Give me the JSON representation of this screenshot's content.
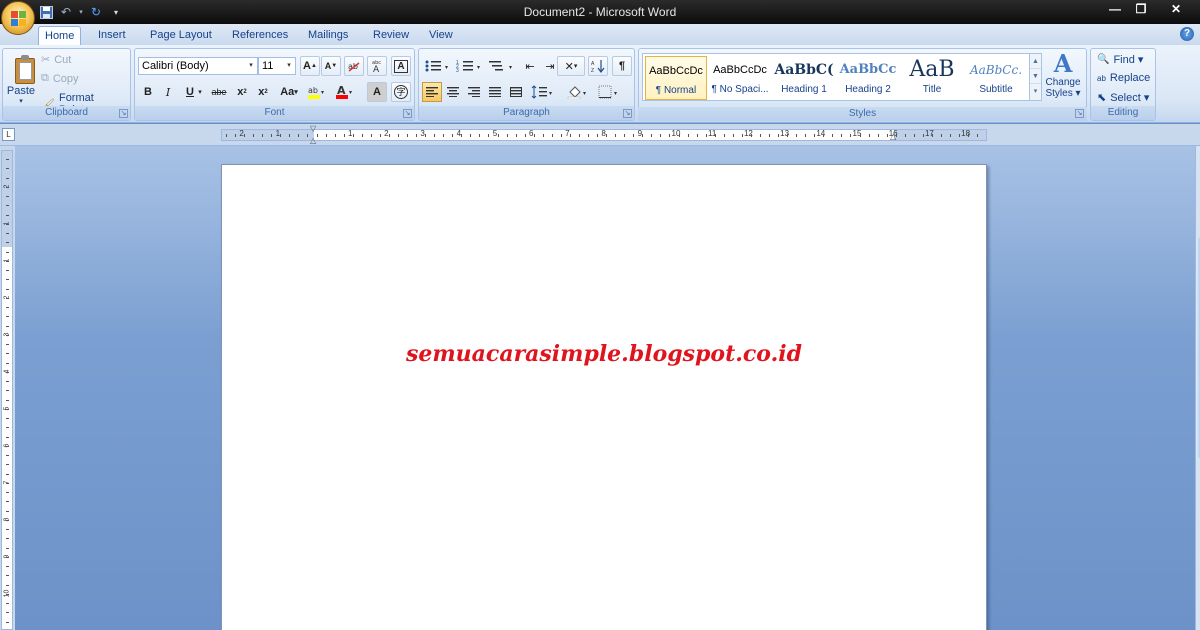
{
  "window": {
    "title": "Document2 - Microsoft Word",
    "minimize": "—",
    "restore": "❐",
    "close": "✕"
  },
  "quick_access": {
    "save": "💾",
    "undo": "↶",
    "redo": "↻",
    "customize": "▾"
  },
  "tabs": [
    "Home",
    "Insert",
    "Page Layout",
    "References",
    "Mailings",
    "Review",
    "View"
  ],
  "ribbon": {
    "clipboard": {
      "label": "Clipboard",
      "paste": "Paste",
      "cut": "Cut",
      "copy": "Copy",
      "format_painter": "Format Painter"
    },
    "font": {
      "label": "Font",
      "font_name": "Calibri (Body)",
      "font_size": "11"
    },
    "paragraph": {
      "label": "Paragraph"
    },
    "styles": {
      "label": "Styles",
      "items": [
        {
          "sample": "AaBbCcDc",
          "name": "¶ Normal"
        },
        {
          "sample": "AaBbCcDc",
          "name": "¶ No Spaci..."
        },
        {
          "sample": "AaBbC(",
          "name": "Heading 1"
        },
        {
          "sample": "AaBbCc",
          "name": "Heading 2"
        },
        {
          "sample": "AaB",
          "name": "Title"
        },
        {
          "sample": "AaBbCc.",
          "name": "Subtitle"
        }
      ],
      "change_styles": "Change",
      "change_styles_2": "Styles ▾"
    },
    "editing": {
      "label": "Editing",
      "find": "Find ▾",
      "replace": "Replace",
      "select": "Select ▾"
    }
  },
  "ruler": {
    "h_left": [
      "2",
      "1"
    ],
    "h_right": [
      "1",
      "2",
      "3",
      "4",
      "5",
      "6",
      "7",
      "8",
      "9",
      "10",
      "11",
      "12",
      "13",
      "14",
      "15",
      "16",
      "17",
      "18"
    ],
    "v_numbers": [
      "2",
      "1",
      "1",
      "2",
      "3",
      "4",
      "5",
      "6",
      "7",
      "8",
      "9",
      "10"
    ]
  },
  "document": {
    "text": "semuacarasimple.blogspot.co.id",
    "text_color": "#e0141d"
  },
  "colors": {
    "ribbon_text": "#15428b",
    "workspace": "#6c92c9",
    "highlight": "#ffff00",
    "font_color": "#ff0000"
  }
}
